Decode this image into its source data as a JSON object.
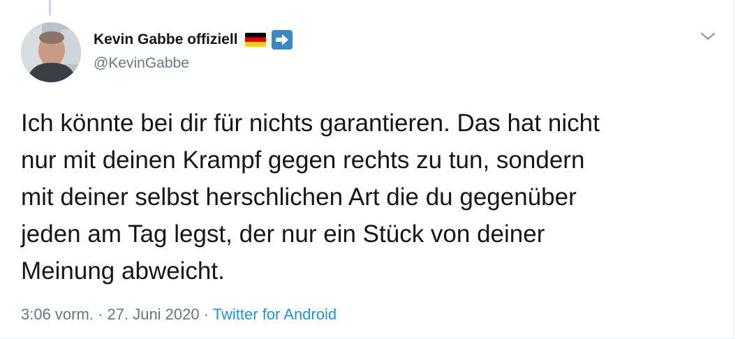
{
  "tweet": {
    "author": {
      "display_name": "Kevin Gabbe offiziell",
      "handle": "@KevinGabbe",
      "badges": [
        "flag-germany-icon",
        "arrow-right-icon"
      ]
    },
    "text": "Ich könnte bei dir für nichts garantieren. Das hat nicht\nnur mit deinen Krampf gegen rechts zu tun, sondern\nmit deiner selbst herschlichen Art die du gegenüber\njeden am Tag legst, der nur ein Stück von deiner\nMeinung abweicht.",
    "time": "3:06 vorm.",
    "separator": "·",
    "date": "27. Juni 2020",
    "source": "Twitter for Android"
  },
  "icons": {
    "caret": "chevron-down-icon"
  },
  "colors": {
    "text": "#14171a",
    "secondary": "#657786",
    "link": "#1b95e0",
    "arrow_badge": "#3b88c3"
  }
}
